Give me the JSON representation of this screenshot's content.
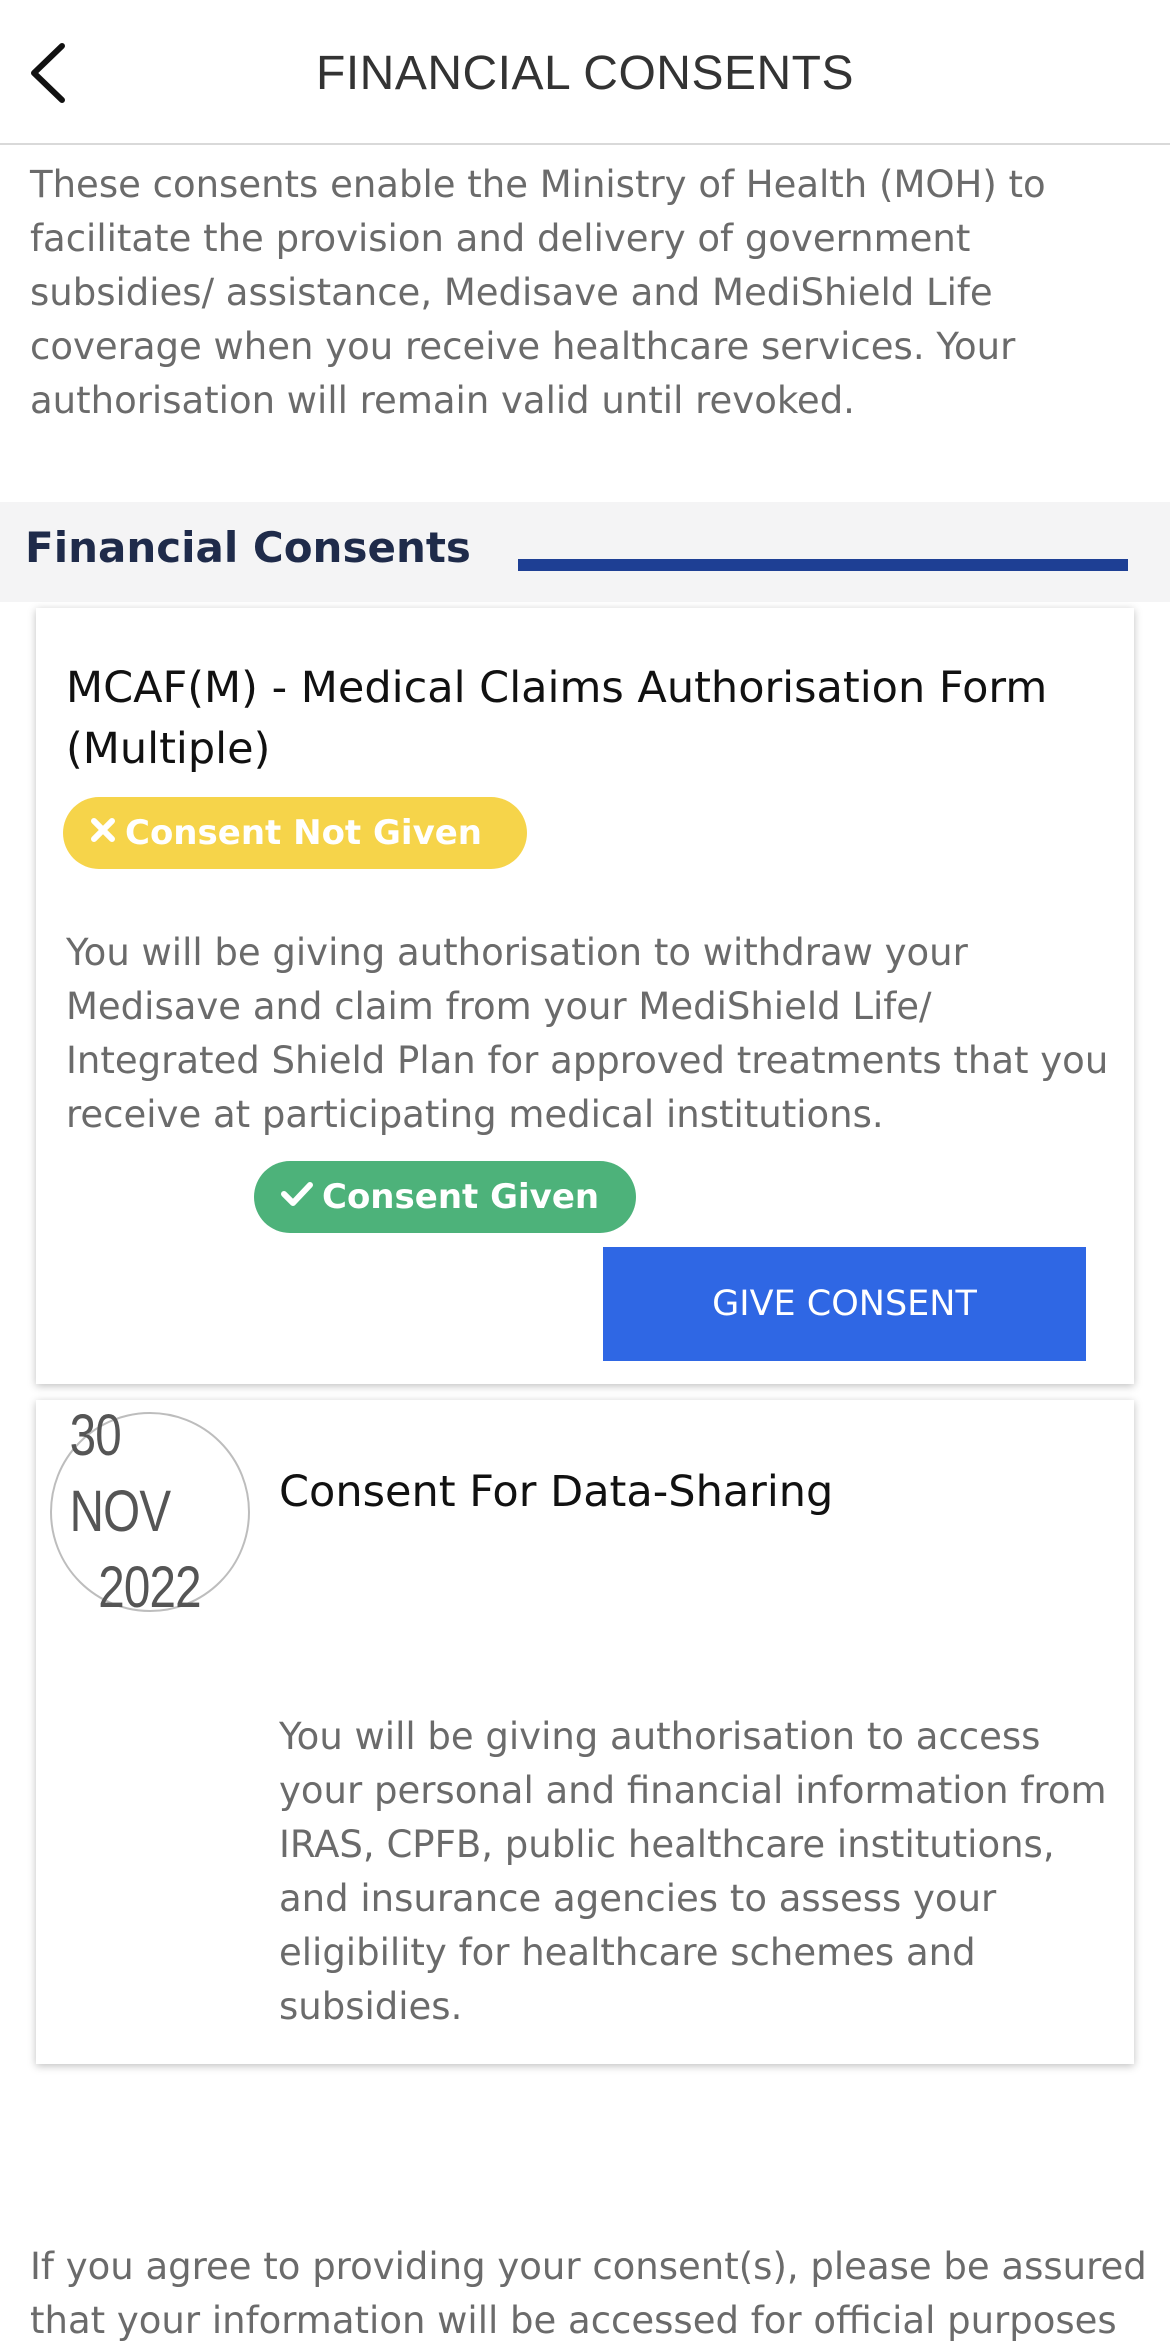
{
  "header": {
    "title": "FINANCIAL CONSENTS",
    "back_icon": "chevron-left-icon"
  },
  "intro": "These consents enable the Ministry of Health (MOH) to facilitate the provision and delivery of government subsidies/ assistance, Medisave and MediShield Life coverage when you receive healthcare services. Your authorisation will remain valid until revoked.",
  "section": {
    "title": "Financial Consents",
    "accent_color": "#1e3f94"
  },
  "cards": [
    {
      "title": "MCAF(M) - Medical Claims Authorisation Form (Multiple)",
      "status": "Consent Not Given",
      "status_icon": "cross-icon",
      "status_color": "#f6d44a",
      "description": "You will be giving authorisation to withdraw your Medisave and claim from your MediShield Life/ Integrated Shield Plan for approved treatments that you receive at participating medical institutions.",
      "action_label": "GIVE CONSENT",
      "action_color": "#2f67e4"
    },
    {
      "date_line1": "30 NOV",
      "date_line2": "2022",
      "title": "Consent For Data-Sharing",
      "status": "Consent Given",
      "status_icon": "check-icon",
      "status_color": "#4db27a",
      "description": "You will be giving authorisation to access your personal and financial information from IRAS, CPFB, public healthcare institutions, and insurance agencies to assess your eligibility for healthcare schemes and subsidies."
    }
  ],
  "footer_note": "If you agree to providing your consent(s), please be assured that your information will be accessed for official purposes"
}
